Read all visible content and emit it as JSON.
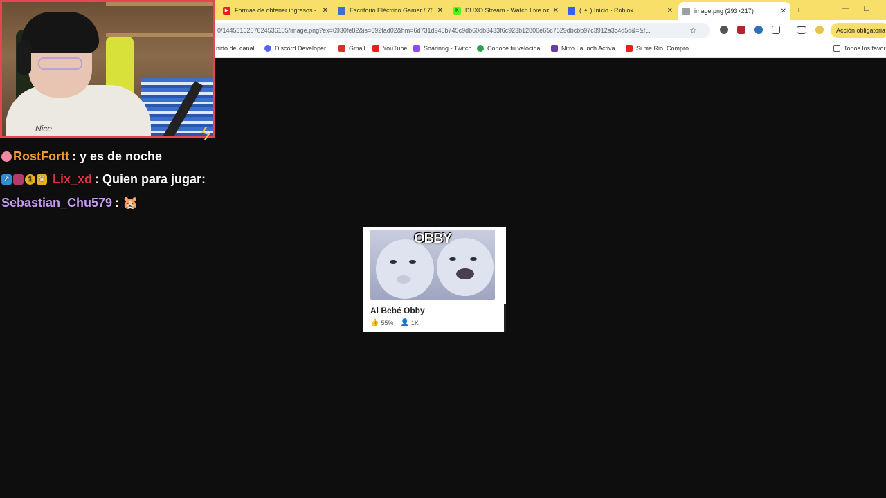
{
  "browser": {
    "tabs": [
      {
        "title": "Formas de obtener ingresos - Y",
        "favicon": "youtube-icon",
        "color": "#e62117"
      },
      {
        "title": "Escritorio Eléctrico Gamer / 75",
        "favicon": "store-icon",
        "color": "#3b6fd6"
      },
      {
        "title": "DUXO Stream - Watch Live on K",
        "favicon": "kick-icon",
        "color": "#53fc18"
      },
      {
        "title": "( ✦ ) Inicio - Roblox",
        "favicon": "roblox-icon",
        "color": "#335fff"
      },
      {
        "title": "image.png (293×217)",
        "favicon": "globe-icon",
        "color": "#777777",
        "active": true
      }
    ],
    "new_tab_label": "+",
    "address": "0/1445616207624536105/image.png?ex=6930fe82&is=692fad02&hm=6d731d945b745c9db60db3433f6c923b12800e65c7529dbcbb97c3912a3c4d5d&=&f...",
    "action_button": "Acción obligatoria",
    "bookmarks": [
      {
        "label": "nido del canal...",
        "color": "#888888"
      },
      {
        "label": "Discord Developer...",
        "color": "#5865f2"
      },
      {
        "label": "Gmail",
        "color": "#d93025"
      },
      {
        "label": "YouTube",
        "color": "#e62117"
      },
      {
        "label": "Soarinng - Twitch",
        "color": "#9146ff"
      },
      {
        "label": "Conoce tu velocida...",
        "color": "#2e9e4f"
      },
      {
        "label": "Nitro Launch Activa...",
        "color": "#6b3fa0"
      },
      {
        "label": "Si me Rio, Compro...",
        "color": "#e62117"
      }
    ],
    "bookmarks_all": "Todos los favori"
  },
  "webcam": {
    "shirt_text": "Nice"
  },
  "chat": [
    {
      "user": "RostFortt",
      "user_color": "#f39a33",
      "message": ": y es de noche"
    },
    {
      "user": "Lix_xd",
      "user_color": "#e0333f",
      "message": ": Quien para jugar:"
    },
    {
      "user": "Sebastian_Chu579",
      "user_color": "#c79bf2",
      "message": ": 🐹"
    }
  ],
  "card": {
    "thumbnail_text": "OBBY",
    "title": "Al Bebé Obby",
    "rating": "55%",
    "players": "1K"
  }
}
